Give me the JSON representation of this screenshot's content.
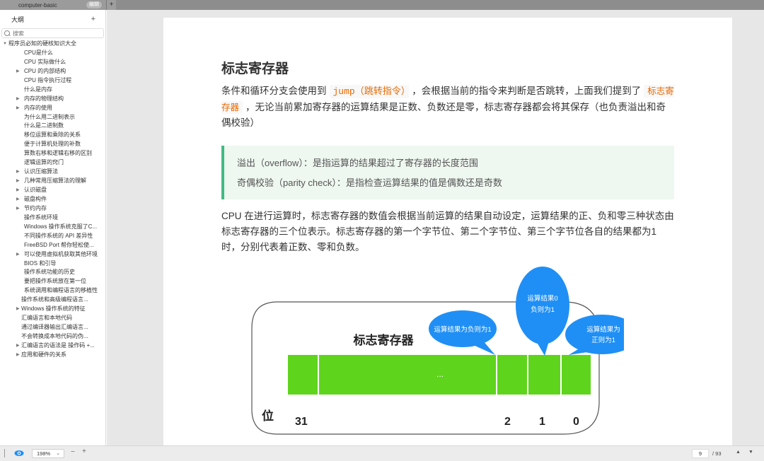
{
  "tabbar": {
    "doc_title": "computer-basic",
    "edit_badge": "编辑",
    "new_tab": "+"
  },
  "sidebar": {
    "title": "大纲",
    "add": "+",
    "search_placeholder": "搜索",
    "items": [
      {
        "label": "程序员必知的硬核知识大全",
        "level": 0,
        "arrow": "▼"
      },
      {
        "label": "CPU是什么",
        "level": 1,
        "arrow": ""
      },
      {
        "label": "CPU 实际做什么",
        "level": 1,
        "arrow": ""
      },
      {
        "label": "CPU 的内部结构",
        "level": 1,
        "arrow": "▶"
      },
      {
        "label": "CPU 指令执行过程",
        "level": 1,
        "arrow": ""
      },
      {
        "label": "什么是内存",
        "level": 1,
        "arrow": ""
      },
      {
        "label": "内存的物理结构",
        "level": 1,
        "arrow": "▶"
      },
      {
        "label": "内存的使用",
        "level": 1,
        "arrow": "▶"
      },
      {
        "label": "为什么用二进制表示",
        "level": 1,
        "arrow": ""
      },
      {
        "label": "什么是二进制数",
        "level": 1,
        "arrow": ""
      },
      {
        "label": "移位运算和乘除的关系",
        "level": 1,
        "arrow": ""
      },
      {
        "label": "便于计算机处理的补数",
        "level": 1,
        "arrow": ""
      },
      {
        "label": "算数右移和逻辑右移的区别",
        "level": 1,
        "arrow": ""
      },
      {
        "label": "逻辑运算的窍门",
        "level": 1,
        "arrow": ""
      },
      {
        "label": "认识压缩算法",
        "level": 1,
        "arrow": "▶"
      },
      {
        "label": "几种常用压缩算法的理解",
        "level": 1,
        "arrow": "▶"
      },
      {
        "label": "认识磁盘",
        "level": 1,
        "arrow": "▶"
      },
      {
        "label": "磁盘构件",
        "level": 1,
        "arrow": "▶"
      },
      {
        "label": "节约内存",
        "level": 1,
        "arrow": "▶"
      },
      {
        "label": "操作系统环境",
        "level": 1,
        "arrow": ""
      },
      {
        "label": "Windows 操作系统克服了C...",
        "level": 1,
        "arrow": ""
      },
      {
        "label": "不同操作系统的 API 差异性",
        "level": 1,
        "arrow": ""
      },
      {
        "label": "FreeBSD Port 帮你轻松使...",
        "level": 1,
        "arrow": ""
      },
      {
        "label": "可以使用虚拟机获取其他环境",
        "level": 1,
        "arrow": "▶"
      },
      {
        "label": "BIOS 和引导",
        "level": 1,
        "arrow": ""
      },
      {
        "label": "操作系统功能的历史",
        "level": 1,
        "arrow": ""
      },
      {
        "label": "要把操作系统放在第一位",
        "level": 1,
        "arrow": ""
      },
      {
        "label": "系统调用和编程语言的移植性",
        "level": 1,
        "arrow": ""
      },
      {
        "label": "操作系统和高级编程语言...",
        "level": 2,
        "arrow": ""
      },
      {
        "label": "Windows 操作系统的特征",
        "level": 2,
        "arrow": "▶"
      },
      {
        "label": "汇编语言和本地代码",
        "level": 2,
        "arrow": ""
      },
      {
        "label": "通过编译器输出汇编语言...",
        "level": 2,
        "arrow": ""
      },
      {
        "label": "不会转换成本地代码的伪...",
        "level": 2,
        "arrow": ""
      },
      {
        "label": "汇编语言的语法是 操作码 +...",
        "level": 2,
        "arrow": "▶"
      },
      {
        "label": "应用和硬件的关系",
        "level": 2,
        "arrow": "▶"
      }
    ]
  },
  "document": {
    "heading": "标志寄存器",
    "para1": {
      "t1": "条件和循环分支会使用到",
      "code1": "jump（跳转指令）",
      "t2": "，会根据当前的指令来判断是否跳转，上面我们提到了",
      "code2": "标志寄存器",
      "t3": "，无论当前累加寄存器的运算结果是正数、负数还是零，标志寄存器都会将其保存（也负责溢出和奇偶校验）"
    },
    "quote": [
      "溢出（overflow）：是指运算的结果超过了寄存器的长度范围",
      "奇偶校验（parity check）：是指检查运算结果的值是偶数还是奇数"
    ],
    "para2": "CPU 在进行运算时，标志寄存器的数值会根据当前运算的结果自动设定，运算结果的正、负和零三种状态由标志寄存器的三个位表示。标志寄存器的第一个字节位、第二个字节位、第三个字节位各自的结果都为1时，分别代表着正数、零和负数。",
    "diagram": {
      "title": "标志寄存器",
      "bit_label": "位",
      "ellipsis": "...",
      "bits": [
        "31",
        "2",
        "1",
        "0"
      ],
      "bubbles": [
        {
          "text": [
            "运算结果为负则为1"
          ],
          "bit": "2"
        },
        {
          "text": [
            "运算结果0",
            "负则为1"
          ],
          "bit": "1"
        },
        {
          "text": [
            "运算结果为",
            "正则为1"
          ],
          "bit": "0"
        }
      ],
      "colors": {
        "cell": "#5fd41c",
        "bubble": "#1f8ff5",
        "frame": "#555555"
      }
    }
  },
  "statusbar": {
    "zoom_level": "198%",
    "zoom_minus": "−",
    "zoom_plus": "+",
    "current_page": "9",
    "total_pages": "/ 93",
    "page_up": "▲",
    "page_down": "▼"
  },
  "colors": {
    "accent_quote": "#42b983",
    "code_text": "#e96900",
    "eye_icon": "#1f8ff5"
  }
}
